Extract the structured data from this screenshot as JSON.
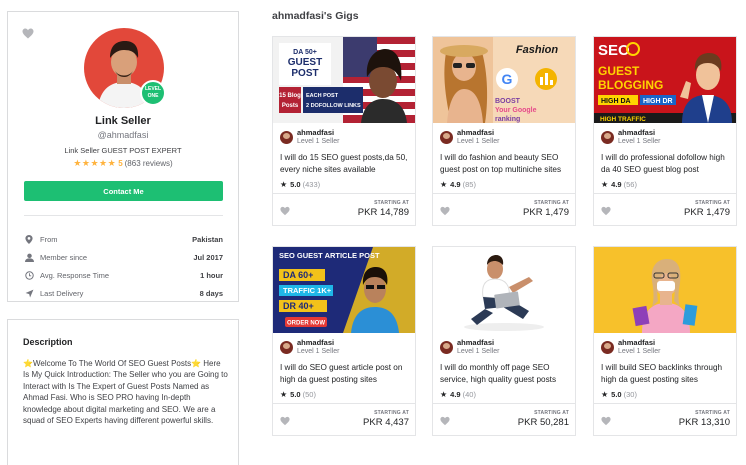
{
  "profile": {
    "level_badge_line1": "LEVEL",
    "level_badge_line2": "ONE",
    "name": "Link Seller",
    "handle": "@ahmadfasi",
    "headline": "Link Seller GUEST POST EXPERT",
    "stars": "★★★★★",
    "rating": "5",
    "reviews": "(863 reviews)",
    "contact_label": "Contact Me",
    "stats": [
      {
        "icon": "location-pin-icon",
        "label": "From",
        "value": "Pakistan"
      },
      {
        "icon": "user-icon",
        "label": "Member since",
        "value": "Jul 2017"
      },
      {
        "icon": "clock-icon",
        "label": "Avg. Response Time",
        "value": "1 hour"
      },
      {
        "icon": "send-icon",
        "label": "Last Delivery",
        "value": "8 days"
      }
    ]
  },
  "description": {
    "title": "Description",
    "body": "⭐Welcome To The World Of SEO Guest Posts⭐ Here Is My Quick Introduction: The Seller who you are Going to Interact with Is The Expert of Guest Posts Named as Ahmad Fasi. Who is SEO PRO having In-depth knowledge about digital marketing and SEO. We are a squad of SEO Experts having different powerful skills."
  },
  "gigs_title": "ahmadfasi's Gigs",
  "gigs": [
    {
      "seller": "ahmadfasi",
      "level": "Level 1 Seller",
      "title": "I will do 15 SEO guest posts,da 50, every niche sites available",
      "rating": "5.0",
      "count": "(433)",
      "starting": "STARTING AT",
      "price": "PKR 14,789",
      "thumb": {
        "l1": "DA 50+",
        "l2": "GUEST",
        "l3": "POST",
        "l4": "15 Blog",
        "l5": "Posts",
        "l6": "EACH POST",
        "l7": "2 DOFOLLOW LINKS"
      }
    },
    {
      "seller": "ahmadfasi",
      "level": "Level 1 Seller",
      "title": "I will do fashion and beauty SEO guest post on top multiniche sites",
      "rating": "4.9",
      "count": "(85)",
      "starting": "STARTING AT",
      "price": "PKR 1,479",
      "thumb": {
        "l1": "Fashion",
        "l2": "BOOST",
        "l3": "Your Google",
        "l4": "ranking"
      }
    },
    {
      "seller": "ahmadfasi",
      "level": "Level 1 Seller",
      "title": "I will do professional dofollow high da 40 SEO guest blog post",
      "rating": "4.9",
      "count": "(56)",
      "starting": "STARTING AT",
      "price": "PKR 1,479",
      "thumb": {
        "l1": "SEO",
        "l2": "GUEST",
        "l3": "BLOGGING",
        "l4": "HIGH DA",
        "l5": "HIGH DR",
        "l6": "HIGH TRAFFIC"
      }
    },
    {
      "seller": "ahmadfasi",
      "level": "Level 1 Seller",
      "title": "I will do SEO guest article post on high da guest posting sites",
      "rating": "5.0",
      "count": "(50)",
      "starting": "STARTING AT",
      "price": "PKR 4,437",
      "thumb": {
        "l1": "SEO GUEST ARTICLE POST",
        "l2": "DA 60+",
        "l3": "TRAFFIC 1K+",
        "l4": "DR 40+",
        "l5": "ORDER NOW"
      }
    },
    {
      "seller": "ahmadfasi",
      "level": "Level 1 Seller",
      "title": "I will do monthly off page SEO service, high quality guest posts",
      "rating": "4.9",
      "count": "(40)",
      "starting": "STARTING AT",
      "price": "PKR 50,281",
      "thumb": {}
    },
    {
      "seller": "ahmadfasi",
      "level": "Level 1 Seller",
      "title": "I will build SEO backlinks through high da guest posting sites",
      "rating": "5.0",
      "count": "(30)",
      "starting": "STARTING AT",
      "price": "PKR 13,310",
      "thumb": {}
    }
  ],
  "colors": {
    "accent": "#1dbf73",
    "star": "#ffb33e",
    "text": "#404145"
  }
}
